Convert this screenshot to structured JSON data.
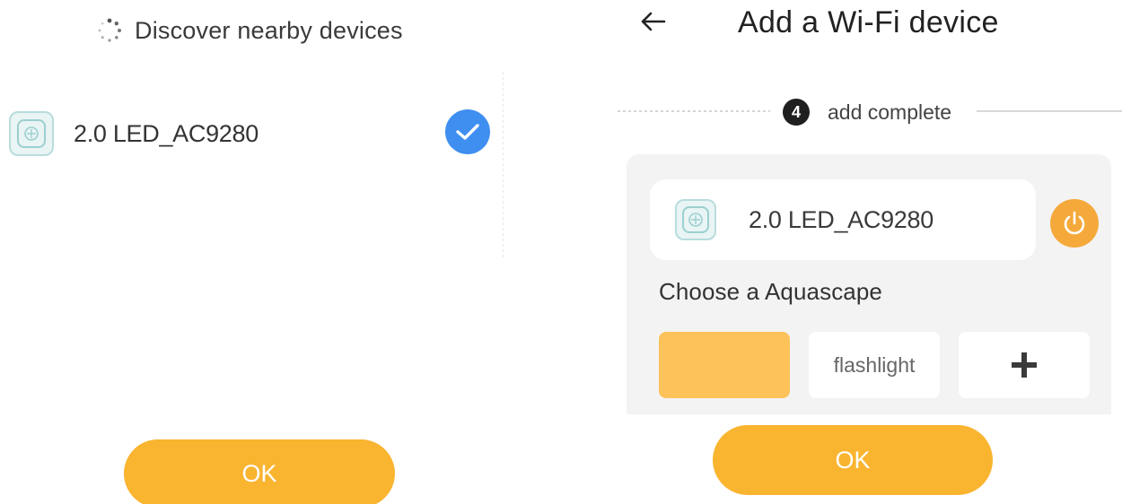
{
  "left_screen": {
    "discover_text": "Discover nearby devices",
    "spinner_icon": "loading-spinner-icon",
    "device": {
      "name": "2.0 LED_AC9280",
      "icon": "light-device-icon",
      "selected": true,
      "check_icon": "checkmark-icon"
    },
    "ok_label": "OK"
  },
  "right_screen": {
    "back_icon": "back-arrow-icon",
    "title": "Add a Wi-Fi device",
    "step": {
      "number": "4",
      "label": "add complete"
    },
    "device_card": {
      "name": "2.0 LED_AC9280",
      "icon": "light-device-icon",
      "power_icon": "power-icon"
    },
    "choose_label": "Choose a Aquascape",
    "aquascapes": [
      {
        "label": "",
        "selected": true
      },
      {
        "label": "flashlight",
        "selected": false
      },
      {
        "label": "",
        "icon": "plus-icon"
      }
    ],
    "ok_label": "OK"
  },
  "colors": {
    "accent": "#f9b430",
    "selected_tile": "#fdc25a",
    "check_blue": "#3f8ff0",
    "power_orange": "#f4a93a",
    "panel_bg": "#f3f3f3"
  }
}
